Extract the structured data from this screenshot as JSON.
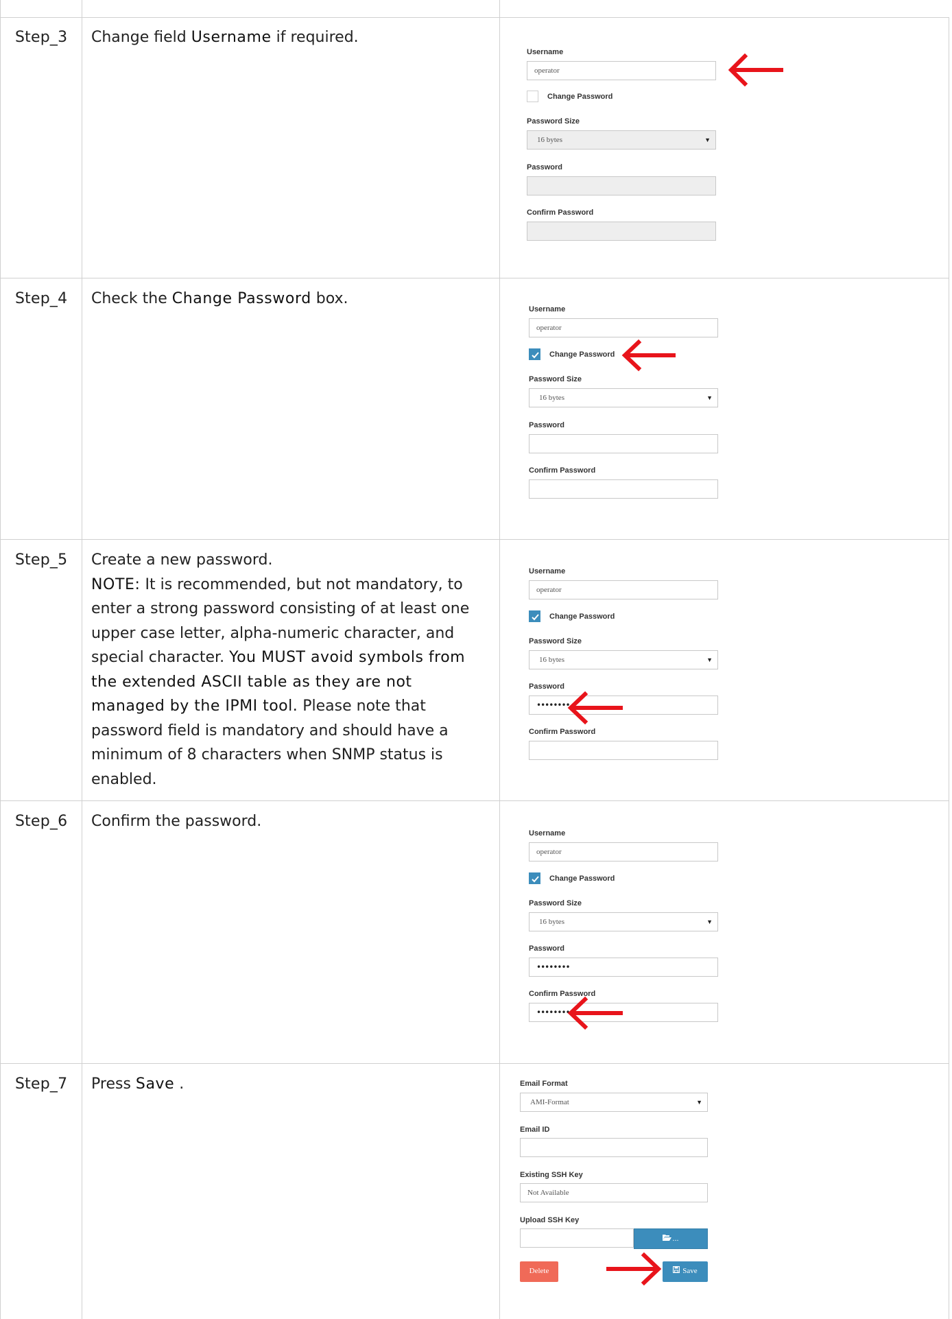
{
  "steps": [
    {
      "id": "Step_3",
      "desc_parts": [
        "Change field ",
        "Username",
        " if required."
      ],
      "form": {
        "username_label": "Username",
        "username_value": "operator",
        "change_password_label": "Change Password",
        "change_password_checked": false,
        "password_size_label": "Password Size",
        "password_size_value": "16 bytes",
        "password_label": "Password",
        "password_value": "",
        "confirm_label": "Confirm Password",
        "confirm_value": ""
      }
    },
    {
      "id": "Step_4",
      "desc_parts": [
        "Check the ",
        "Change Password",
        " box."
      ],
      "form": {
        "username_label": "Username",
        "username_value": "operator",
        "change_password_label": "Change Password",
        "change_password_checked": true,
        "password_size_label": "Password Size",
        "password_size_value": "16 bytes",
        "password_label": "Password",
        "password_value": "",
        "confirm_label": "Confirm Password",
        "confirm_value": ""
      }
    },
    {
      "id": "Step_5",
      "desc_line1": "Create a new password.",
      "note_label": "NOTE:",
      "note_text": " It is recommended, but not mandatory, to enter a strong password consisting of at least one upper case letter, alpha-numeric character, and special character. ",
      "note_strong": "You MUST avoid symbols from the extended ASCII table as they are not managed by the IPMI tool.",
      "note_tail": " Please note that password field is mandatory and should have a minimum of 8 characters when SNMP status is enabled.",
      "form": {
        "username_label": "Username",
        "username_value": "operator",
        "change_password_label": "Change Password",
        "change_password_checked": true,
        "password_size_label": "Password Size",
        "password_size_value": "16 bytes",
        "password_label": "Password",
        "password_value": "••••••••",
        "confirm_label": "Confirm Password",
        "confirm_value": ""
      }
    },
    {
      "id": "Step_6",
      "desc_parts": [
        "Confirm the password.",
        "",
        ""
      ],
      "form": {
        "username_label": "Username",
        "username_value": "operator",
        "change_password_label": "Change Password",
        "change_password_checked": true,
        "password_size_label": "Password Size",
        "password_size_value": "16 bytes",
        "password_label": "Password",
        "password_value": "••••••••",
        "confirm_label": "Confirm Password",
        "confirm_value": "••••••••"
      }
    },
    {
      "id": "Step_7",
      "desc_parts": [
        "Press ",
        "Save",
        " ."
      ],
      "form": {
        "email_format_label": "Email Format",
        "email_format_value": "AMI-Format",
        "email_id_label": "Email ID",
        "email_id_value": "",
        "ssh_key_label": "Existing SSH Key",
        "ssh_key_value": "Not Available",
        "upload_label": "Upload SSH Key",
        "browse_label": "...",
        "delete_label": "Delete",
        "save_label": "Save"
      }
    }
  ],
  "colors": {
    "arrow": "#e8141b",
    "primary": "#3c8dbc",
    "danger": "#f06a58",
    "grid": "#d0d0d0"
  }
}
